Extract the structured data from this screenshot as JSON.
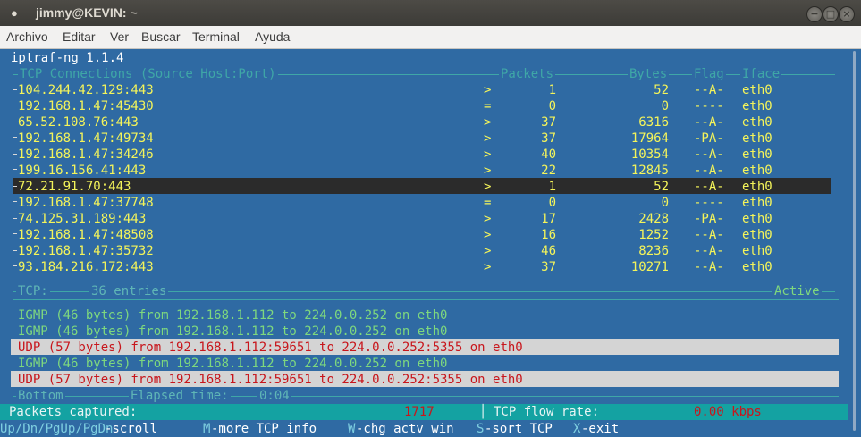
{
  "window": {
    "title": "jimmy@KEVIN: ~"
  },
  "menu": [
    "Archivo",
    "Editar",
    "Ver",
    "Buscar",
    "Terminal",
    "Ayuda"
  ],
  "app": {
    "version_line": "iptraf-ng 1.1.4"
  },
  "tcp_header": {
    "title": "TCP Connections (Source Host:Port)",
    "packets": "Packets",
    "bytes": "Bytes",
    "flag": "Flag",
    "iface": "Iface"
  },
  "tcp_rows": [
    {
      "host": "104.244.42.129:443",
      "dir": ">",
      "packets": "1",
      "bytes": "52",
      "flag": "--A-",
      "iface": "eth0"
    },
    {
      "host": "192.168.1.47:45430",
      "dir": "=",
      "packets": "0",
      "bytes": "0",
      "flag": "----",
      "iface": "eth0"
    },
    {
      "host": "65.52.108.76:443",
      "dir": ">",
      "packets": "37",
      "bytes": "6316",
      "flag": "--A-",
      "iface": "eth0"
    },
    {
      "host": "192.168.1.47:49734",
      "dir": ">",
      "packets": "37",
      "bytes": "17964",
      "flag": "-PA-",
      "iface": "eth0"
    },
    {
      "host": "192.168.1.47:34246",
      "dir": ">",
      "packets": "40",
      "bytes": "10354",
      "flag": "--A-",
      "iface": "eth0"
    },
    {
      "host": "199.16.156.41:443",
      "dir": ">",
      "packets": "22",
      "bytes": "12845",
      "flag": "--A-",
      "iface": "eth0"
    },
    {
      "host": "72.21.91.70:443",
      "dir": ">",
      "packets": "1",
      "bytes": "52",
      "flag": "--A-",
      "iface": "eth0"
    },
    {
      "host": "192.168.1.47:37748",
      "dir": "=",
      "packets": "0",
      "bytes": "0",
      "flag": "----",
      "iface": "eth0"
    },
    {
      "host": "74.125.31.189:443",
      "dir": ">",
      "packets": "17",
      "bytes": "2428",
      "flag": "-PA-",
      "iface": "eth0"
    },
    {
      "host": "192.168.1.47:48508",
      "dir": ">",
      "packets": "16",
      "bytes": "1252",
      "flag": "--A-",
      "iface": "eth0"
    },
    {
      "host": "192.168.1.47:35732",
      "dir": ">",
      "packets": "46",
      "bytes": "8236",
      "flag": "--A-",
      "iface": "eth0"
    },
    {
      "host": "93.184.216.172:443",
      "dir": ">",
      "packets": "37",
      "bytes": "10271",
      "flag": "--A-",
      "iface": "eth0"
    }
  ],
  "tcp_footer": {
    "label": "TCP:",
    "entries": "36 entries",
    "status": "Active"
  },
  "other_packets": [
    {
      "text": "IGMP (46 bytes) from 192.168.1.112 to 224.0.0.252 on eth0"
    },
    {
      "text": "IGMP (46 bytes) from 192.168.1.112 to 224.0.0.252 on eth0"
    },
    {
      "text": "UDP (57 bytes) from 192.168.1.112:59651 to 224.0.0.252:5355 on eth0"
    },
    {
      "text": "IGMP (46 bytes) from 192.168.1.112 to 224.0.0.252 on eth0"
    },
    {
      "text": "UDP (57 bytes) from 192.168.1.112:59651 to 224.0.0.252:5355 on eth0"
    }
  ],
  "bottom_rule": {
    "label": "Bottom",
    "elapsed_label": "Elapsed time:",
    "elapsed": "0:04"
  },
  "stats": {
    "packets_label": "Packets captured:",
    "packets_value": "1717",
    "flow_label": "TCP flow rate:",
    "flow_value": "0.00 kbps"
  },
  "keys": {
    "scroll_key": "Up/Dn/PgUp/PgDn",
    "scroll_label": "-scroll",
    "more_key": "M",
    "more_label": "-more TCP info",
    "win_key": "W",
    "win_label": "-chg actv win",
    "sort_key": "S",
    "sort_label": "-sort TCP",
    "exit_key": "X",
    "exit_label": "-exit"
  },
  "colors": {
    "terminal_bg": "#2f6aa3",
    "highlight_yellow": "#f4f45a",
    "other_green": "#7ed87e",
    "udp_red": "#c8161c",
    "status_cyan": "#14a2a2"
  },
  "selected_row": 6,
  "udp_highlight_rows": [
    2,
    4
  ]
}
